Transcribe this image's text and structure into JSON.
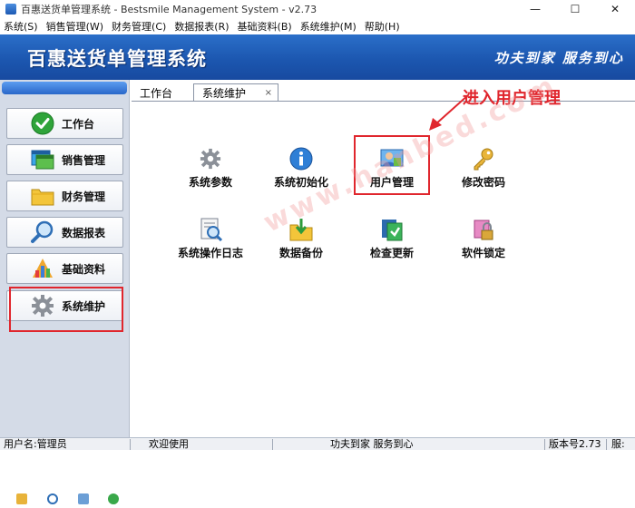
{
  "window": {
    "title": "百惠送货单管理系统 - Bestsmile Management System - v2.73",
    "min_btn": "—",
    "max_btn": "☐",
    "close_btn": "✕"
  },
  "menubar": [
    {
      "label": "系统(S)"
    },
    {
      "label": "销售管理(W)"
    },
    {
      "label": "财务管理(C)"
    },
    {
      "label": "数据报表(R)"
    },
    {
      "label": "基础资料(B)"
    },
    {
      "label": "系统维护(M)"
    },
    {
      "label": "帮助(H)"
    }
  ],
  "banner": {
    "title": "百惠送货单管理系统",
    "slogan": "功夫到家 服务到心"
  },
  "sidebar": {
    "items": [
      {
        "label": "工作台",
        "icon": "check-icon"
      },
      {
        "label": "销售管理",
        "icon": "window-icon"
      },
      {
        "label": "财务管理",
        "icon": "folder-icon"
      },
      {
        "label": "数据报表",
        "icon": "magnifier-icon"
      },
      {
        "label": "基础资料",
        "icon": "chart-icon"
      },
      {
        "label": "系统维护",
        "icon": "gear-icon",
        "highlighted": true
      }
    ],
    "bottom_icons": [
      "edit-icon",
      "clock-icon",
      "search-icon",
      "refresh-icon"
    ]
  },
  "tabs": [
    {
      "label": "工作台",
      "active": false
    },
    {
      "label": "系统维护",
      "active": true,
      "close": "×"
    }
  ],
  "tools": [
    {
      "label": "系统参数",
      "icon": "gear-icon"
    },
    {
      "label": "系统初始化",
      "icon": "info-icon"
    },
    {
      "label": "用户管理",
      "icon": "user-icon",
      "highlighted": true
    },
    {
      "label": "修改密码",
      "icon": "key-icon"
    },
    {
      "label": "系统操作日志",
      "icon": "log-icon"
    },
    {
      "label": "数据备份",
      "icon": "backup-folder-icon"
    },
    {
      "label": "检查更新",
      "icon": "update-icon"
    },
    {
      "label": "软件锁定",
      "icon": "lock-icon"
    }
  ],
  "annotation": {
    "text": "进入用户管理",
    "color": "#e0262d"
  },
  "watermark": "www.hanbed.com",
  "statusbar": {
    "user": "用户名:管理员",
    "welcome": "欢迎使用",
    "slogan": "功夫到家 服务到心",
    "version": "版本号2.73",
    "extra": "服:"
  },
  "colors": {
    "banner": "#1c57b0",
    "highlight": "#e0262d",
    "sidebar_bg": "#d4dbe7"
  }
}
